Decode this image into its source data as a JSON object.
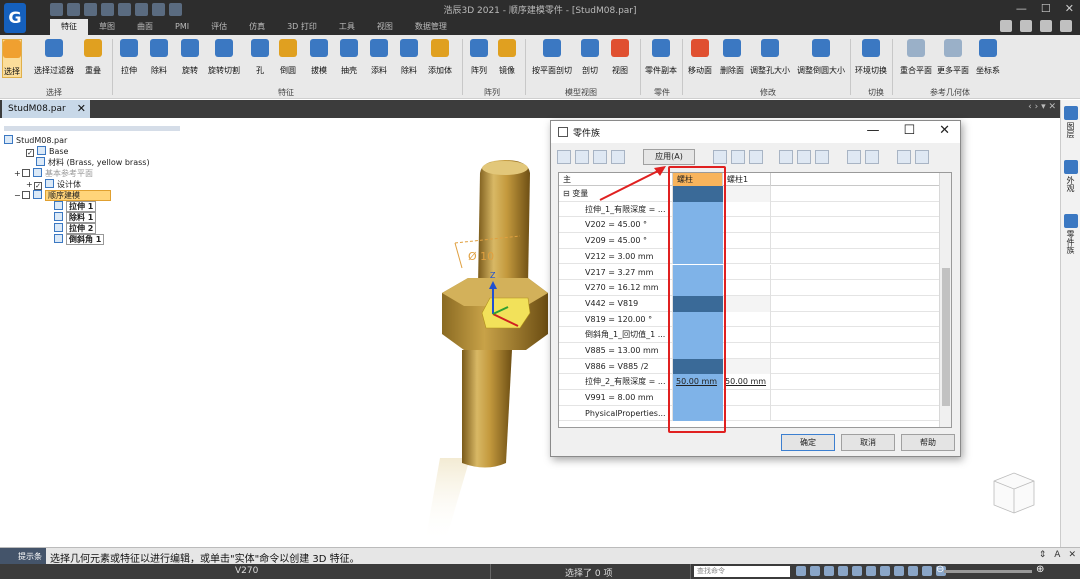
{
  "app": {
    "title": "浩辰3D 2021 - 顺序建模零件 - [StudM08.par]"
  },
  "ribbon": {
    "tabs": [
      "特征",
      "草图",
      "曲面",
      "PMI",
      "评估",
      "仿真",
      "3D 打印",
      "工具",
      "视图",
      "数据管理"
    ],
    "tools": [
      {
        "label": "选择",
        "color": "#f0a030"
      },
      {
        "label": "选择过滤器",
        "color": "#3b78c2"
      },
      {
        "label": "重叠",
        "color": "#e0a020"
      },
      {
        "label": "拉伸",
        "color": "#3b78c2"
      },
      {
        "label": "除料",
        "color": "#3b78c2"
      },
      {
        "label": "旋转",
        "color": "#3b78c2"
      },
      {
        "label": "旋转切割",
        "color": "#3b78c2"
      },
      {
        "label": "孔",
        "color": "#3b78c2"
      },
      {
        "label": "倒圆",
        "color": "#e0a020"
      },
      {
        "label": "拔模",
        "color": "#3b78c2"
      },
      {
        "label": "抽壳",
        "color": "#3b78c2"
      },
      {
        "label": "添料",
        "color": "#3b78c2"
      },
      {
        "label": "除料",
        "color": "#3b78c2"
      },
      {
        "label": "添加体",
        "color": "#e0a020"
      },
      {
        "label": "阵列",
        "color": "#3b78c2"
      },
      {
        "label": "镜像",
        "color": "#e0a020"
      },
      {
        "label": "按平面剖切",
        "color": "#3b78c2"
      },
      {
        "label": "剖切",
        "color": "#3b78c2"
      },
      {
        "label": "视图",
        "color": "#e05030"
      },
      {
        "label": "零件副本",
        "color": "#3b78c2"
      },
      {
        "label": "移动面",
        "color": "#e05030"
      },
      {
        "label": "删除面",
        "color": "#3b78c2"
      },
      {
        "label": "调整孔大小",
        "color": "#3b78c2"
      },
      {
        "label": "调整倒圆大小",
        "color": "#3b78c2"
      },
      {
        "label": "环境切换",
        "color": "#3b78c2"
      },
      {
        "label": "重合平面",
        "color": "#9ab0c8"
      },
      {
        "label": "更多平面",
        "color": "#9ab0c8"
      },
      {
        "label": "坐标系",
        "color": "#3b78c2"
      }
    ],
    "groups": [
      "选择",
      "特征",
      "阵列",
      "模型视图",
      "零件",
      "修改",
      "切换",
      "参考几何体"
    ]
  },
  "document": {
    "tab_label": "StudM08.par",
    "tab_close": "✕",
    "nav": "‹ › ▾ ✕"
  },
  "side_panel": [
    "图层",
    "外观",
    "零件族"
  ],
  "tree": {
    "nodes": [
      {
        "label": "StudM08.par",
        "kind": "root"
      },
      {
        "label": "Base",
        "kind": "checked"
      },
      {
        "label": "材料 (Brass, yellow brass)",
        "kind": "item"
      },
      {
        "label": "基本参考平面",
        "kind": "dim"
      },
      {
        "label": "设计体",
        "kind": "checked"
      },
      {
        "label": "顺序建模",
        "kind": "seq"
      },
      {
        "label": "拉伸 1",
        "kind": "feature"
      },
      {
        "label": "除料 1",
        "kind": "feature"
      },
      {
        "label": "拉伸 2",
        "kind": "feature"
      },
      {
        "label": "倒斜角 1",
        "kind": "feature"
      }
    ]
  },
  "model": {
    "dimension_label": "Ø 10"
  },
  "dialog": {
    "title": "零件族",
    "apply_label": "应用(A)",
    "columns": {
      "main": "主",
      "stud": "螺柱",
      "stud1": "螺柱1"
    },
    "rows": [
      {
        "name": "变量",
        "kind": "group",
        "v1": "",
        "v2": ""
      },
      {
        "name": "拉伸_1_有限深度 = ...",
        "kind": "row",
        "v1": "",
        "v2": ""
      },
      {
        "name": "V202 = 45.00 °",
        "kind": "row",
        "v1": "",
        "v2": ""
      },
      {
        "name": "V209 = 45.00 °",
        "kind": "row",
        "v1": "",
        "v2": ""
      },
      {
        "name": "V212 = 3.00 mm",
        "kind": "row",
        "v1": "",
        "v2": ""
      },
      {
        "name": "V217 = 3.27 mm",
        "kind": "row",
        "v1": "",
        "v2": ""
      },
      {
        "name": "V270 = 16.12 mm",
        "kind": "row",
        "v1": "",
        "v2": ""
      },
      {
        "name": "V442 = V819",
        "kind": "dark",
        "v1": "",
        "v2": ""
      },
      {
        "name": "V819 = 120.00 °",
        "kind": "row",
        "v1": "",
        "v2": ""
      },
      {
        "name": "倒斜角_1_回切值_1 ...",
        "kind": "row",
        "v1": "",
        "v2": ""
      },
      {
        "name": "V885 = 13.00 mm",
        "kind": "row",
        "v1": "",
        "v2": ""
      },
      {
        "name": "V886 = V885 /2",
        "kind": "dark",
        "v1": "",
        "v2": ""
      },
      {
        "name": "拉伸_2_有限深度 = ...",
        "kind": "row",
        "v1": "50.00 mm",
        "v2": "50.00 mm"
      },
      {
        "name": "V991 = 8.00 mm",
        "kind": "row",
        "v1": "",
        "v2": ""
      },
      {
        "name": "PhysicalProperties...",
        "kind": "row",
        "v1": "",
        "v2": ""
      }
    ],
    "buttons": {
      "ok": "确定",
      "cancel": "取消",
      "help": "帮助"
    }
  },
  "command_bar": {
    "label": "提示条",
    "prompt": "选择几何元素或特征以进行编辑，或单击\"实体\"命令以创建 3D 特征。"
  },
  "status_bar": {
    "variable": "V270",
    "selection": "选择了 0 项",
    "search_placeholder": "查找命令"
  },
  "colors": {
    "accent": "#1560bd",
    "highlight_border": "#e02020",
    "selected_column": "#7fb3e8",
    "header_orange": "#f8b45c"
  }
}
